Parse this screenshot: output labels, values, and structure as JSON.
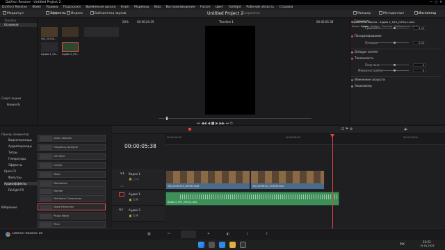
{
  "window": {
    "title": "DaVinci Resolve - Untitled Project 2"
  },
  "menu": [
    "DaVinci Resolve",
    "Файл",
    "Правка",
    "Подсказка",
    "Временная шкала",
    "Клип",
    "Маркеры",
    "Вид",
    "Воспроизведение",
    "Fusion",
    "Цвет",
    "Fairlight",
    "Рабочий область",
    "Справка"
  ],
  "toolbar": {
    "media_pool": "Медиапул",
    "effects": "Эффекты",
    "index": "Указатель",
    "edit_index": "Индекс",
    "sound_library": "Библиотека звуков",
    "project_title": "Untitled Project 2",
    "saved": "Сохранено",
    "mixer": "Микшер",
    "metadata": "Метаданные",
    "inspector": "Инспектор"
  },
  "media_pool": {
    "folders_title": "Timeline",
    "master": "Основной",
    "smart_bins": "Смарт-ящики",
    "keywords": "Keywords",
    "clips": [
      {
        "name": "VID_20230..."
      },
      {
        "name": "Аудио 2_00..."
      },
      {
        "name": ""
      },
      {
        "name": "Аудио 2_00..."
      }
    ]
  },
  "viewer": {
    "zoom": "20%",
    "timecode": "00:00:24:39",
    "timeline_name": "Timeline 1",
    "end_timecode": "00:00:05:38"
  },
  "effects_panel": {
    "tree": [
      "Панель элементов",
      "Видеопереходы",
      "Аудиопереходы",
      "Титры",
      "Генераторы",
      "Эффекты",
      "Open FX",
      "Фильтры",
      "Аудиоэффекты",
      "Fairlight FX"
    ],
    "favorites": "Избранное",
    "list": [
      "Delay Sampler",
      "Frequency Analyzer",
      "LFE Filter",
      "Limiter",
      "Meter",
      "Modulation",
      "Monitor",
      "Multiband Compressor",
      "Noise Reduction",
      "Phase Meter",
      "Pitch"
    ],
    "selected": "Noise Reduction"
  },
  "inspector": {
    "header": "Временная шкала - Аудио 2_003_(CRO).L.wav",
    "tabs": [
      "Видео",
      "Аудио",
      "Эффект",
      "Переход",
      "Изображение",
      "Файл"
    ],
    "volume_section": "Громкость",
    "volume_label": "Громкость",
    "volume_value": "0.00",
    "pan_section": "Панорамирование",
    "pan_label": "Панорам",
    "pan_value": "0.00",
    "dialogue": "Dialogue Leveler",
    "pitch_section": "Тональность",
    "semitones_label": "Полутона",
    "semitones_value": "0",
    "cents_label": "Микронастройка",
    "cents_value": "0",
    "speed_change": "Изменение скорости",
    "eq": "Эквалайзер"
  },
  "timeline": {
    "current_tc": "00:00:05:38",
    "ruler": [
      "00:00:00:00",
      "",
      "00:00:05:00",
      "",
      "00:00:10:00"
    ],
    "tracks": [
      {
        "id": "V1",
        "name": "Видео 1",
        "clips": [
          "VID_20230101_203535.mp4",
          "VID_20230101_203535.mp4"
        ]
      },
      {
        "id": "A1",
        "name": "Аудио 1",
        "clips": [
          "Аудио 2_003_(CRO).L.wav"
        ]
      },
      {
        "id": "A2",
        "name": "Аудио 2",
        "clips": []
      }
    ],
    "clip_count": "2.0"
  },
  "app_footer": "DaVinci Resolve 18",
  "taskbar": {
    "lang": "РУС",
    "time": "22:23",
    "date": "15.01.2023"
  }
}
